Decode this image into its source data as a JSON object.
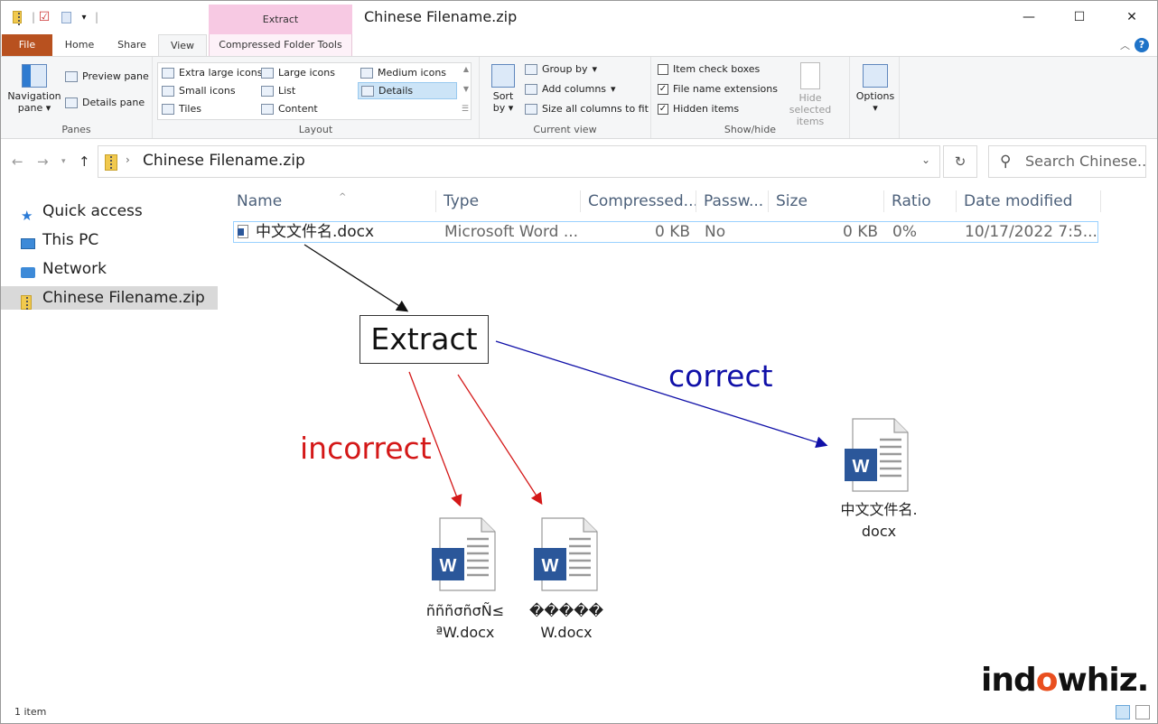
{
  "window": {
    "title": "Chinese Filename.zip",
    "context_tab_label": "Extract",
    "controls": {
      "minimize": "—",
      "maximize": "☐",
      "close": "✕"
    }
  },
  "ribbon_tabs": {
    "file": "File",
    "home": "Home",
    "share": "Share",
    "view": "View",
    "compressed": "Compressed Folder Tools"
  },
  "ribbon": {
    "panes": {
      "label": "Panes",
      "navigation_pane": "Navigation pane",
      "preview_pane": "Preview pane",
      "details_pane": "Details pane"
    },
    "layout": {
      "label": "Layout",
      "extra_large_icons": "Extra large icons",
      "large_icons": "Large icons",
      "medium_icons": "Medium icons",
      "small_icons": "Small icons",
      "list": "List",
      "details": "Details",
      "tiles": "Tiles",
      "content": "Content"
    },
    "current_view": {
      "label": "Current view",
      "sort_by": "Sort by",
      "group_by": "Group by",
      "add_columns": "Add columns",
      "size_all_columns": "Size all columns to fit"
    },
    "show_hide": {
      "label": "Show/hide",
      "item_check_boxes": "Item check boxes",
      "file_name_extensions": "File name extensions",
      "hidden_items": "Hidden items",
      "hide_selected_items": "Hide selected items"
    },
    "options": "Options"
  },
  "address": {
    "path": "Chinese Filename.zip",
    "search_placeholder": "Search Chinese..."
  },
  "nav_pane": {
    "items": [
      {
        "label": "Quick access"
      },
      {
        "label": "This PC"
      },
      {
        "label": "Network"
      },
      {
        "label": "Chinese Filename.zip"
      }
    ]
  },
  "columns": [
    "Name",
    "Type",
    "Compressed...",
    "Passw...",
    "Size",
    "Ratio",
    "Date modified"
  ],
  "file": {
    "name": "中文文件名.docx",
    "type": "Microsoft Word ...",
    "compressed": "0 KB",
    "password": "No",
    "size": "0 KB",
    "ratio": "0%",
    "date": "10/17/2022 7:5..."
  },
  "annotations": {
    "extract": "Extract",
    "correct": "correct",
    "incorrect": "incorrect",
    "correct_file": "中文文件名.docx",
    "incorrect_file_1": "ñññσñσÑ≤ªW.docx",
    "incorrect_file_2": "�����W.docx",
    "doc_letter": "W"
  },
  "brand": {
    "pre": "ind",
    "o": "o",
    "post": "whiz."
  },
  "status": {
    "items": "1 item"
  },
  "colors": {
    "file_tab": "#b8511f",
    "context_tab": "#f7c9e3",
    "correct": "#1010a8",
    "incorrect": "#d41818",
    "word_blue": "#2b579a"
  }
}
